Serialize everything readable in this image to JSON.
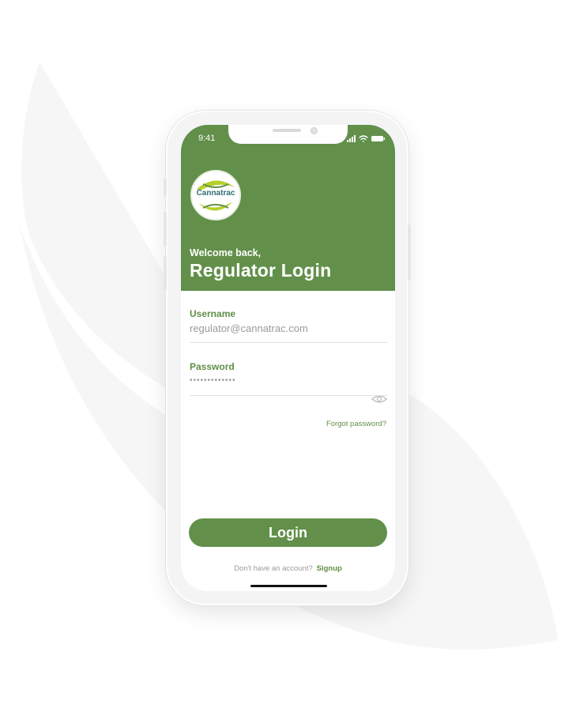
{
  "colors": {
    "brand_green": "#62904a",
    "label_green": "#5f8f46",
    "muted_text": "#9a9a9a",
    "background_leaf": "#f5f5f6"
  },
  "status_bar": {
    "time": "9:41",
    "icons": [
      "signal-icon",
      "wifi-icon",
      "battery-icon"
    ]
  },
  "logo": {
    "text": "Cannatrac"
  },
  "header": {
    "welcome": "Welcome back,",
    "title": "Regulator Login"
  },
  "form": {
    "username_label": "Username",
    "username_value": "regulator@cannatrac.com",
    "password_label": "Password",
    "password_value": "•••••••••••••",
    "password_toggle_icon": "eye-icon",
    "forgot_password": "Forgot password?",
    "login_button": "Login"
  },
  "signup": {
    "prefix": "Don't have an account?",
    "link": "Signup"
  }
}
